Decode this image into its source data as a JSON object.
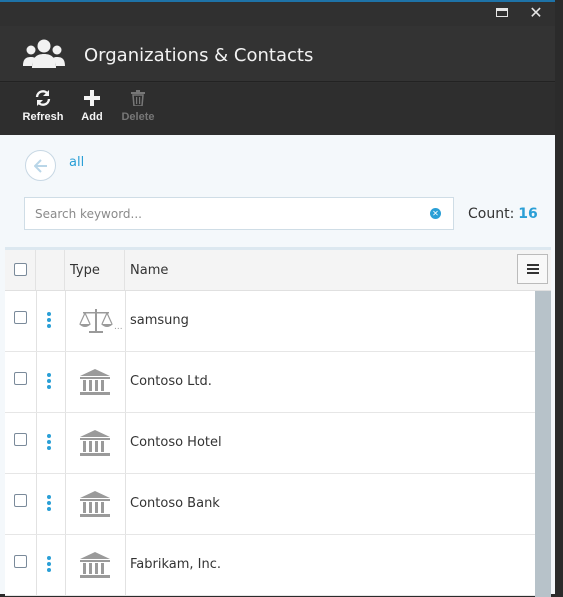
{
  "window": {
    "maximize_label": "maximize",
    "close_label": "✕"
  },
  "header": {
    "title": "Organizations & Contacts",
    "icon": "contacts-group-icon"
  },
  "toolbar": {
    "refresh_label": "Refresh",
    "add_label": "Add",
    "delete_label": "Delete"
  },
  "filter": {
    "back_label": "all"
  },
  "search": {
    "placeholder": "Search keyword...",
    "value": ""
  },
  "count": {
    "label": "Count:",
    "value": "16"
  },
  "grid": {
    "columns": [
      "Type",
      "Name"
    ],
    "rows": [
      {
        "type_icon": "scales-icon",
        "type_suffix": "...",
        "name": "samsung"
      },
      {
        "type_icon": "building-icon",
        "name": "Contoso Ltd."
      },
      {
        "type_icon": "building-icon",
        "name": "Contoso Hotel"
      },
      {
        "type_icon": "building-icon",
        "name": "Contoso Bank"
      },
      {
        "type_icon": "building-icon",
        "name": "Fabrikam, Inc."
      }
    ]
  },
  "colors": {
    "accent": "#2a9fd6",
    "header_bg": "#333333",
    "content_bg": "#f4f8fb"
  }
}
